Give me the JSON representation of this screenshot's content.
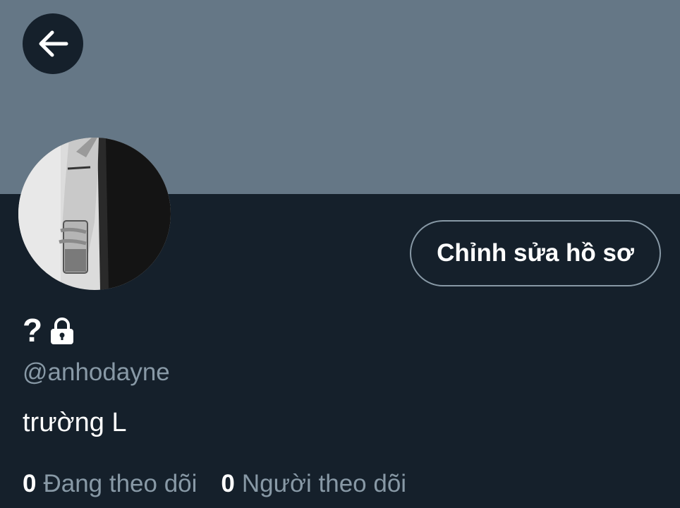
{
  "profile": {
    "display_name": "?",
    "handle": "@anhodayne",
    "bio": "trường L",
    "edit_button_label": "Chỉnh sửa hồ sơ",
    "following_count": "0",
    "following_label": "Đang theo dõi",
    "followers_count": "0",
    "followers_label": "Người theo dõi"
  },
  "icons": {
    "back": "arrow-left-icon",
    "lock": "lock-icon"
  },
  "colors": {
    "background": "#15202b",
    "banner": "#657786",
    "secondary_text": "#8899a6",
    "primary_text": "#ffffff",
    "button_border": "#8899a6"
  }
}
